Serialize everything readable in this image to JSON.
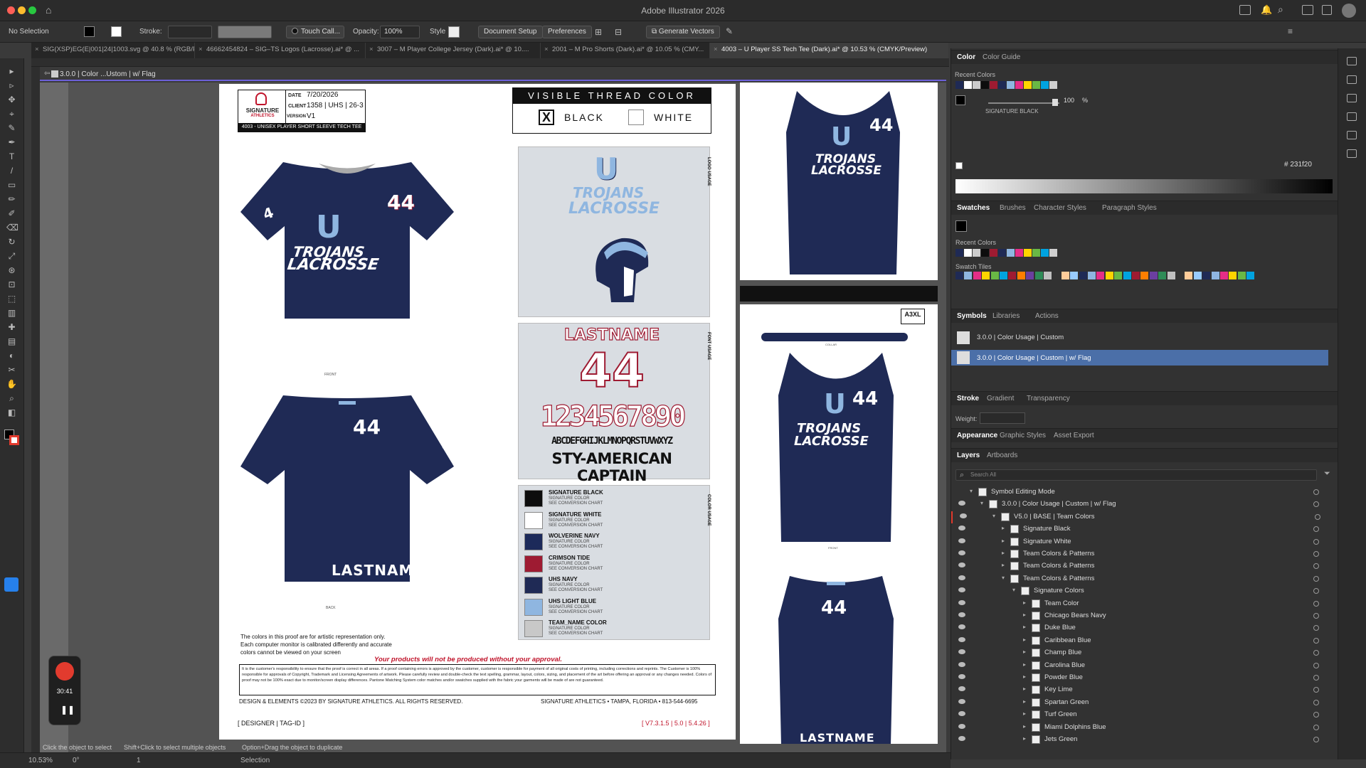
{
  "window": {
    "title": "Adobe Illustrator 2026"
  },
  "control_bar": {
    "selection": "No Selection",
    "stroke_label": "Stroke:",
    "brush_name": "Touch Call...",
    "opacity_label": "Opacity:",
    "opacity_value": "100%",
    "style_label": "Style",
    "document_setup": "Document Setup",
    "preferences": "Preferences",
    "generate_vectors": "Generate Vectors"
  },
  "doc_tabs": [
    {
      "label": "SIG(XSP)EG(E|001|24|1003.svg @ 40.8 % (RGB/P..."
    },
    {
      "label": "46662454824 – SIG–TS Logos (Lacrosse).ai* @ ..."
    },
    {
      "label": "3007 – M Player College Jersey (Dark).ai* @ 10...."
    },
    {
      "label": "2001 – M Pro Shorts (Dark).ai* @ 10.05 % (CMY..."
    },
    {
      "label": "4003 – U Player SS Tech Tee (Dark).ai* @ 10.53 % (CMYK/Preview)"
    }
  ],
  "breadcrumb": "3.0.0 | Color ...Ustom | w/ Flag",
  "proof": {
    "brand_line1": "SIGNATURE",
    "brand_line2": "ATHLETICS",
    "date_label": "DATE",
    "date_value": "7/20/2026",
    "client_label": "CLIENT",
    "client_value": "1358 | UHS | 26-3",
    "version_label": "VERSION",
    "version_value": "V1",
    "product_line": "4003 - UNISEX PLAYER SHORT SLEEVE TECH TEE",
    "thread_title": "VISIBLE THREAD COLOR",
    "thread_black": "BLACK",
    "thread_black_mark": "X",
    "thread_white": "WHITE",
    "team_letter": "U",
    "team_name_1": "TROJANS",
    "team_name_2": "LACROSSE",
    "number": "44",
    "sleeve_number": "4",
    "lastname": "LASTNAME",
    "front_label": "FRONT",
    "back_label": "BACK",
    "logo_usage": "LOGO USAGE",
    "font_usage": "FONT USAGE",
    "color_usage": "COLOR USAGE",
    "font_sample_name": "LASTNAME",
    "font_sample_number": "44",
    "font_digits": "1234567890",
    "font_alphabet": "ABCDEFGHIJKLMNOPQRSTUVWXYZ",
    "font_name": "STY-AMERICAN CAPTAIN",
    "swatch_sub1": "SIGNATURE COLOR",
    "swatch_sub2": "SEE CONVERSION CHART",
    "swatches": [
      {
        "name": "SIGNATURE BLACK",
        "color": "#0d0d0d"
      },
      {
        "name": "SIGNATURE WHITE",
        "color": "#ffffff"
      },
      {
        "name": "WOLVERINE NAVY",
        "color": "#1c2a5a"
      },
      {
        "name": "CRIMSON TIDE",
        "color": "#9e1b32"
      },
      {
        "name": "UHS NAVY",
        "color": "#1f2a55"
      },
      {
        "name": "UHS LIGHT BLUE",
        "color": "#8fb6e0"
      },
      {
        "name": "TEAM_NAME COLOR",
        "color": "#c8c8c8"
      }
    ],
    "disclaimer_1": "The colors in this proof are for artistic representation only.",
    "disclaimer_2": "Each computer monitor is calibrated differently and accurate",
    "disclaimer_3": "colors cannot be viewed on your screen",
    "approval_notice": "Your products will not be produced without your approval.",
    "legal_text": "It is the customer's responsibility to ensure that the proof is correct in all areas. If a proof containing errors is approved by the customer, customer is responsible for payment of all original costs of printing, including corrections and reprints. The Customer is 100% responsible for approvals of Copyright, Trademark and Licensing Agreements of artwork. Please carefully review and double-check the text spelling, grammar, layout, colors, sizing, and placement of the art before offering an approval or any changes needed. Colors of proof may not be 100% exact due to monitor/screen display differences. Pantone Matching System color matches and/or swatches supplied with the fabric your garments will be made of are not guaranteed.",
    "copyright": "DESIGN & ELEMENTS ©2023 BY SIGNATURE ATHLETICS. ALL RIGHTS RESERVED.",
    "address": "SIGNATURE ATHLETICS • TAMPA, FLORIDA • 813-544-6695",
    "designer_tag": "[ DESIGNER | TAG-ID ]",
    "version_tag": "[ V7.3.1.5 | 5.0 | 5.4.26 ]",
    "size_tag": "A3XL",
    "collar_label": "COLLAR"
  },
  "color_panel": {
    "tab_color": "Color",
    "tab_guide": "Color Guide",
    "recent_colors": "Recent Colors",
    "tint_value": "100",
    "tint_unit": "%",
    "swatch_name": "SIGNATURE BLACK",
    "hex_label": "#",
    "hex_value": "231f20",
    "recent": [
      "#1f2a55",
      "#ffffff",
      "#cccccc",
      "#0d0d0d",
      "#9e1b32",
      "#1f2a55",
      "#8fb6e0",
      "#e52d87",
      "#ffd400",
      "#69b845",
      "#00a3e0",
      "#d0d0d0"
    ]
  },
  "swatches_panel": {
    "tabs": [
      "Swatches",
      "Brushes",
      "Character Styles",
      "Paragraph Styles"
    ],
    "recent_colors": "Recent Colors",
    "swatch_tiles": "Swatch Tiles"
  },
  "symbols_panel": {
    "tabs": [
      "Symbols",
      "Libraries",
      "Actions"
    ],
    "items": [
      "3.0.0 | Color Usage | Custom",
      "3.0.0 | Color Usage | Custom | w/ Flag"
    ]
  },
  "stroke_panel": {
    "tabs": [
      "Stroke",
      "Gradient",
      "Transparency"
    ],
    "weight_label": "Weight:"
  },
  "appearance_panel": {
    "tabs": [
      "Appearance",
      "Graphic Styles",
      "Asset Export"
    ]
  },
  "layers_panel": {
    "tabs": [
      "Layers",
      "Artboards"
    ],
    "search_placeholder": "Search All",
    "rows": [
      {
        "label": "Symbol Editing Mode",
        "indent": 0
      },
      {
        "label": "3.0.0 | Color Usage | Custom | w/ Flag",
        "indent": 1
      },
      {
        "label": "V5.0 | BASE | Team Colors",
        "indent": 2
      },
      {
        "label": "Signature Black",
        "indent": 3
      },
      {
        "label": "Signature White",
        "indent": 3
      },
      {
        "label": "Team Colors & Patterns",
        "indent": 3
      },
      {
        "label": "Team Colors & Patterns",
        "indent": 3
      },
      {
        "label": "Team Colors & Patterns",
        "indent": 3
      },
      {
        "label": "Signature Colors",
        "indent": 4
      },
      {
        "label": "Team Color",
        "indent": 5
      },
      {
        "label": "Chicago Bears Navy",
        "indent": 5
      },
      {
        "label": "Duke Blue",
        "indent": 5
      },
      {
        "label": "Caribbean Blue",
        "indent": 5
      },
      {
        "label": "Champ Blue",
        "indent": 5
      },
      {
        "label": "Carolina Blue",
        "indent": 5
      },
      {
        "label": "Powder Blue",
        "indent": 5
      },
      {
        "label": "Key Lime",
        "indent": 5
      },
      {
        "label": "Spartan Green",
        "indent": 5
      },
      {
        "label": "Turf Green",
        "indent": 5
      },
      {
        "label": "Miami Dolphins Blue",
        "indent": 5
      },
      {
        "label": "Jets Green",
        "indent": 5
      }
    ]
  },
  "status": {
    "zoom": "10.53%",
    "rotation": "0°",
    "artboard_num": "1",
    "tool": "Selection",
    "hint_1": "Click the object to select",
    "hint_2": "Shift+Click to select multiple objects",
    "hint_3": "Option+Drag the object to duplicate"
  },
  "recorder": {
    "time": "30:41"
  },
  "colors": {
    "navy": "#1f2a55",
    "light_blue": "#8fb6e0",
    "crimson": "#9e1b32",
    "accent": "#6c60d8"
  }
}
